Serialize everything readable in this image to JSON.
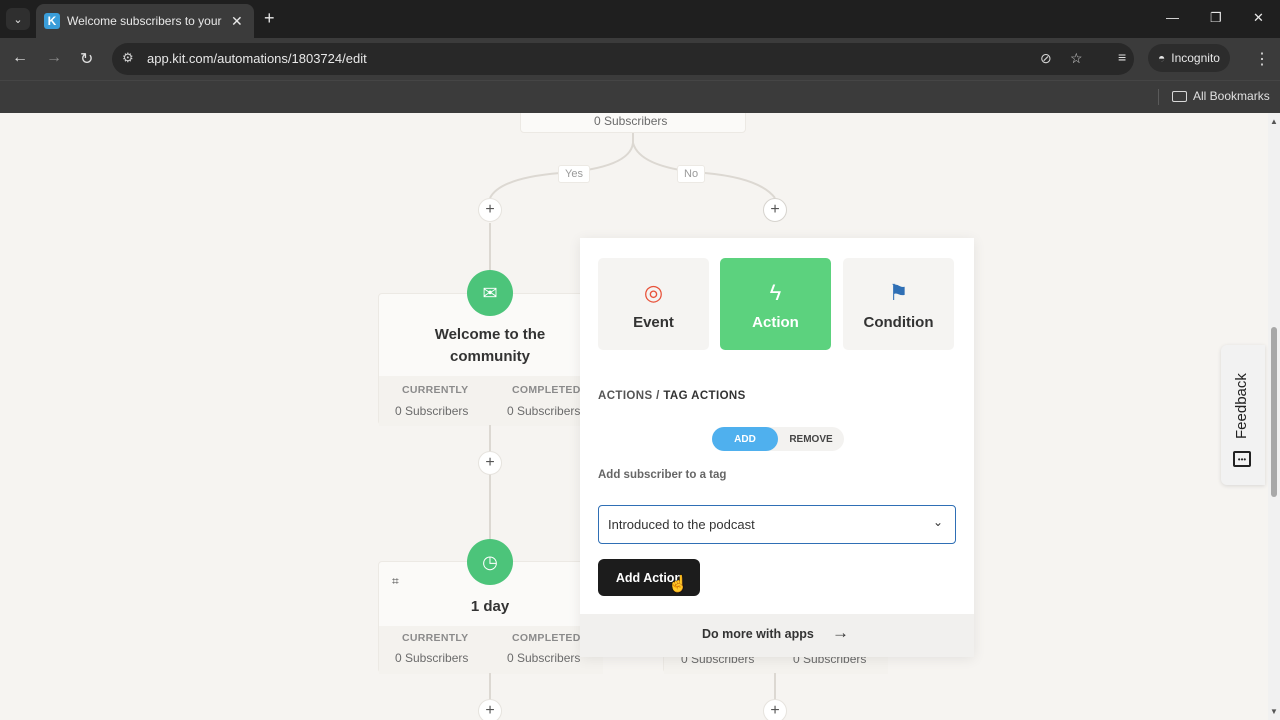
{
  "browser": {
    "tab_title": "Welcome subscribers to your p",
    "tab_favicon_letter": "K",
    "url": "app.kit.com/automations/1803724/edit",
    "incognito_label": "Incognito",
    "bookmarks_label": "All Bookmarks"
  },
  "canvas": {
    "top_card_subscribers": "0 Subscribers",
    "branch_yes": "Yes",
    "branch_no": "No",
    "email_card": {
      "title": "Welcome to the community",
      "currently_label": "CURRENTLY",
      "completed_label": "COMPLETED",
      "currently_value": "0 Subscribers",
      "completed_value": "0 Subscribers"
    },
    "delay_card": {
      "title": "1 day",
      "currently_label": "CURRENTLY",
      "completed_label": "COMPLETED",
      "currently_value": "0 Subscribers",
      "completed_value": "0 Subscribers"
    },
    "right_card": {
      "currently_value": "0 Subscribers",
      "completed_value": "0 Subscribers"
    }
  },
  "panel": {
    "types": [
      {
        "label": "Event",
        "icon": "target-icon"
      },
      {
        "label": "Action",
        "icon": "bolt-icon",
        "active": true
      },
      {
        "label": "Condition",
        "icon": "signpost-icon"
      }
    ],
    "breadcrumb_root": "ACTIONS",
    "breadcrumb_sep": " / ",
    "breadcrumb_current": "TAG ACTIONS",
    "toggle_add": "ADD",
    "toggle_remove": "REMOVE",
    "field_label": "Add subscriber to a tag",
    "select_value": "Introduced to the podcast",
    "add_button": "Add Action",
    "footer_link": "Do more with apps"
  },
  "feedback_label": "Feedback",
  "colors": {
    "accent_green": "#5cd27e",
    "toggle_blue": "#4fb0ee",
    "event_red": "#e8533b",
    "condition_blue": "#2f6fb5"
  }
}
